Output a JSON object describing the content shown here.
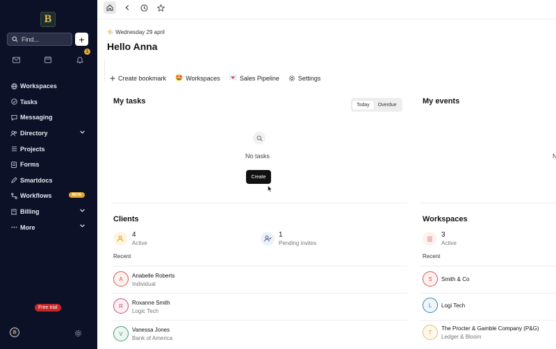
{
  "sidebar": {
    "logo_letter": "B",
    "find_placeholder": "Find...",
    "notification_count": "1",
    "items": [
      {
        "label": "Workspaces",
        "icon": "globe-icon"
      },
      {
        "label": "Tasks",
        "icon": "check-circle-icon"
      },
      {
        "label": "Messaging",
        "icon": "chat-icon"
      },
      {
        "label": "Directory",
        "icon": "users-icon",
        "expandable": true
      },
      {
        "label": "Projects",
        "icon": "list-icon"
      },
      {
        "label": "Forms",
        "icon": "document-icon"
      },
      {
        "label": "Smartdocs",
        "icon": "pen-icon"
      },
      {
        "label": "Workflows",
        "icon": "flow-icon",
        "badge": "BETA"
      },
      {
        "label": "Billing",
        "icon": "receipt-icon",
        "expandable": true
      },
      {
        "label": "More",
        "icon": "dots-icon",
        "expandable": true
      }
    ],
    "free_trial": "Free trial",
    "user_initial": "B"
  },
  "header": {
    "date": "Wednesday 29 april",
    "greeting": "Hello Anna"
  },
  "quick_links": [
    {
      "label": "Create bookmark",
      "icon": "plus-icon"
    },
    {
      "label": "Workspaces",
      "icon": "emoji-face-icon",
      "glyph": "🤩"
    },
    {
      "label": "Sales Pipeline",
      "icon": "emoji-heart-icon",
      "glyph": "💌"
    },
    {
      "label": "Settings",
      "icon": "gear-icon"
    }
  ],
  "tasks": {
    "title": "My tasks",
    "filters": [
      "Today",
      "Overdue"
    ],
    "empty_text": "No tasks",
    "create_label": "Create"
  },
  "events": {
    "title": "My events",
    "cut_text": "N"
  },
  "clients": {
    "title": "Clients",
    "stats": [
      {
        "value": "4",
        "label": "Active"
      },
      {
        "value": "1",
        "label": "Pending invites"
      }
    ],
    "recent_label": "Recent",
    "rows": [
      {
        "initial": "A",
        "name": "Anabelle Roberts",
        "sub": "Individual",
        "color": "#d9534f"
      },
      {
        "initial": "R",
        "name": "Roxanne Smith",
        "sub": "Logic Tech",
        "color": "#c94a7a"
      },
      {
        "initial": "V",
        "name": "Vanessa Jones",
        "sub": "Bank of America",
        "color": "#3f9b6a"
      }
    ]
  },
  "workspaces": {
    "title": "Workspaces",
    "stats": [
      {
        "value": "3",
        "label": "Active"
      }
    ],
    "recent_label": "Recent",
    "rows": [
      {
        "initial": "S",
        "name": "Smith & Co",
        "sub": "",
        "color": "#d9534f"
      },
      {
        "initial": "L",
        "name": "Logi Tech",
        "sub": "",
        "color": "#3a7fb0"
      },
      {
        "initial": "T",
        "name": "The Procter & Gamble Company (P&G)",
        "sub": "Ledger & Bloom",
        "color": "#e0a92c"
      }
    ]
  }
}
